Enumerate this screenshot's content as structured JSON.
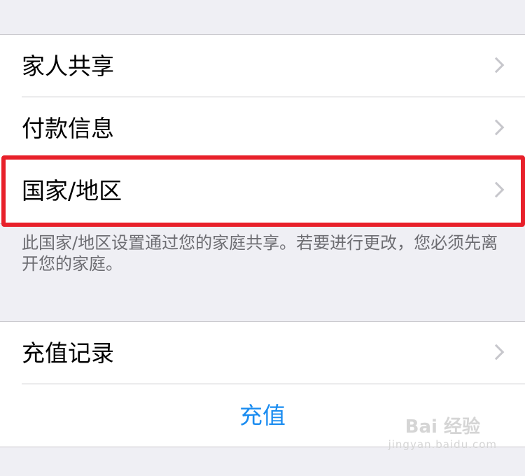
{
  "group1": {
    "items": [
      {
        "label": "家人共享"
      },
      {
        "label": "付款信息"
      },
      {
        "label": "国家/地区"
      }
    ]
  },
  "footnote": {
    "text": "此国家/地区设置通过您的家庭共享。若要进行更改，您必须先离开您的家庭。"
  },
  "group2": {
    "items": [
      {
        "label": "充值记录"
      }
    ],
    "action_label": "充值"
  },
  "watermark": {
    "main": "Bai 经验",
    "url": "jingyan.baidu.com"
  },
  "colors": {
    "background": "#efeff4",
    "cell": "#ffffff",
    "separator": "#c8c7cc",
    "chevron": "#c7c7cc",
    "footnote": "#6d6d72",
    "action": "#1a8cf0",
    "highlight": "#e8202a"
  }
}
